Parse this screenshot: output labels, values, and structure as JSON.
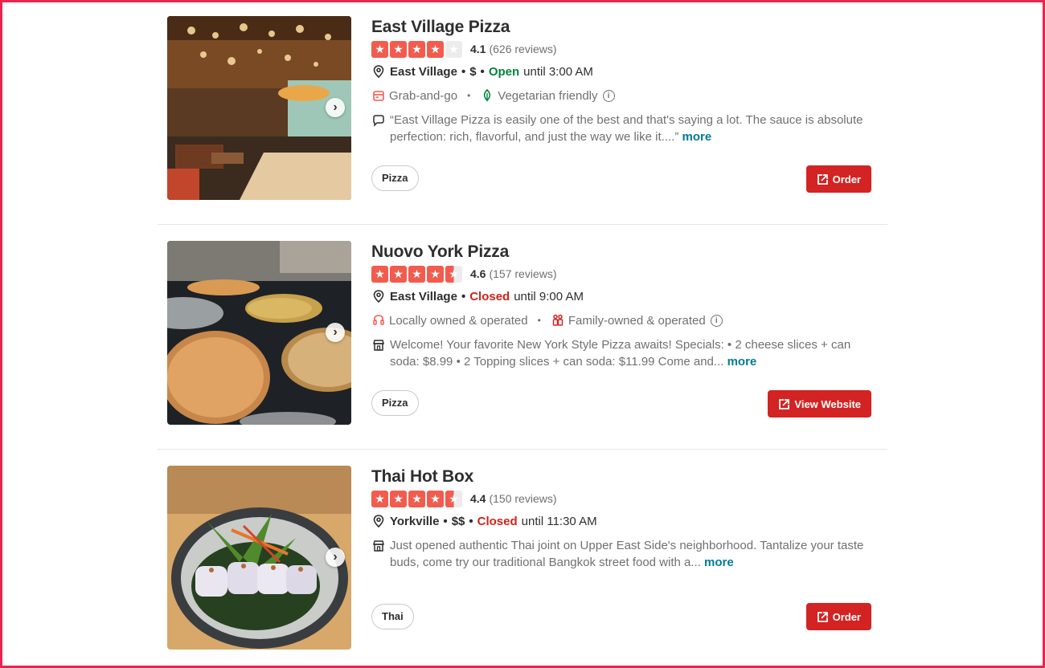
{
  "listings": [
    {
      "name": "East Village Pizza",
      "rating": "4.1",
      "rating_value": 4.1,
      "reviews": "(626 reviews)",
      "neighborhood": "East Village",
      "price": "$",
      "status": "Open",
      "hours": "until 3:00 AM",
      "amenities": [
        "Grab-and-go",
        "Vegetarian friendly"
      ],
      "snippet": "“East Village Pizza is easily one of the best and that's saying a lot. The sauce is absolute perfection: rich, flavorful, and just the way we like it....”",
      "more": "more",
      "tag": "Pizza",
      "cta": "Order",
      "photo_icon": "restaurant-interior-photo"
    },
    {
      "name": "Nuovo York Pizza",
      "rating": "4.6",
      "rating_value": 4.6,
      "reviews": "(157 reviews)",
      "neighborhood": "East Village",
      "status": "Closed",
      "hours": "until 9:00 AM",
      "amenities": [
        "Locally owned & operated",
        "Family-owned & operated"
      ],
      "snippet": "Welcome! Your favorite New York Style Pizza awaits! Specials: • 2 cheese slices + can soda: $8.99 • 2 Topping slices + can soda: $11.99 Come and...",
      "more": "more",
      "tag": "Pizza",
      "cta": "View Website",
      "photo_icon": "pizza-counter-photo"
    },
    {
      "name": "Thai Hot Box",
      "rating": "4.4",
      "rating_value": 4.4,
      "reviews": "(150 reviews)",
      "neighborhood": "Yorkville",
      "price": "$$",
      "status": "Closed",
      "hours": "until 11:30 AM",
      "snippet": "Just opened authentic Thai joint on Upper East Side's neighborhood. Tantalize your taste buds, come try our traditional Bangkok street food with a...",
      "more": "more",
      "tag": "Thai",
      "cta": "Order",
      "photo_icon": "thai-dish-photo"
    }
  ],
  "colors": {
    "star": "#f15c4f",
    "open": "#04843d",
    "closed": "#d0221a",
    "cta": "#d32323",
    "link": "#027a97",
    "frame": "#e8254f"
  }
}
